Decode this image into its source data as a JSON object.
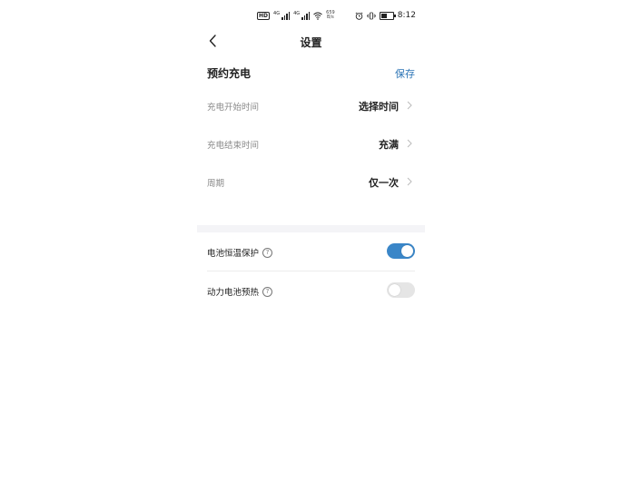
{
  "status_bar": {
    "hd_label": "HD",
    "net_a": "4G",
    "net_b": "4G",
    "speed_value": "659",
    "speed_unit": "B/s",
    "battery_level": 0.55,
    "time": "8:12"
  },
  "header": {
    "title": "设置",
    "back_icon": "chevron-left-icon"
  },
  "schedule": {
    "title": "预约充电",
    "save_label": "保存",
    "rows": [
      {
        "label": "充电开始时间",
        "value": "选择时间"
      },
      {
        "label": "充电结束时间",
        "value": "充满"
      },
      {
        "label": "周期",
        "value": "仅一次"
      }
    ]
  },
  "toggles": [
    {
      "label": "电池恒温保护",
      "help": "?",
      "on": true
    },
    {
      "label": "动力电池预热",
      "help": "?",
      "on": false
    }
  ],
  "colors": {
    "accent": "#2a73b5",
    "toggle_on": "#3a86c8",
    "toggle_off": "#e5e5e5",
    "band": "#f4f4f7"
  }
}
